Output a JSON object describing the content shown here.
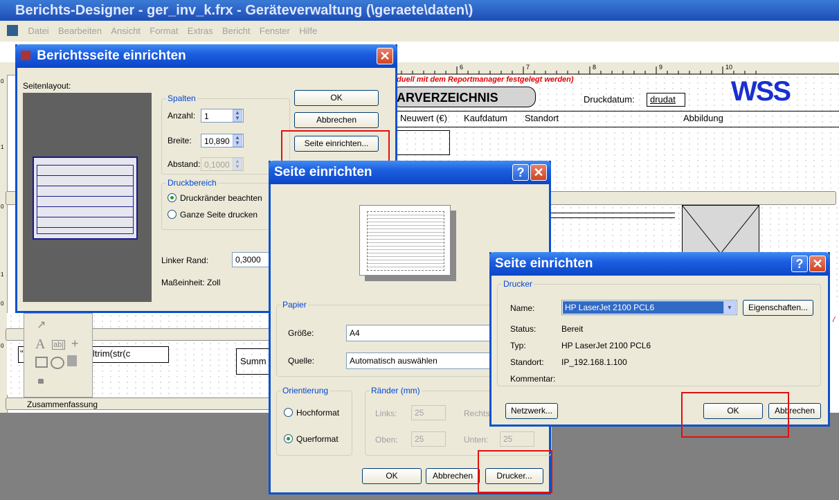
{
  "app": {
    "title": "Berichts-Designer - ger_inv_k.frx - Geräteverwaltung (\\geraete\\daten\\)",
    "menu": [
      "Datei",
      "Bearbeiten",
      "Ansicht",
      "Format",
      "Extras",
      "Bericht",
      "Fenster",
      "Hilfe"
    ]
  },
  "report": {
    "ruler_numbers": [
      "6",
      "7",
      "8",
      "9",
      "10"
    ],
    "vruler_numbers": [
      "0",
      "1",
      "0",
      "1",
      "0",
      "0"
    ],
    "banner_text": "iduell mit dem Reportmanager festgelegt werden)",
    "title_box": "ARVERZEICHNIS",
    "druckdatum_label": "Druckdatum:",
    "druckdatum_field": "drudat",
    "logo": "WSS",
    "columns": [
      "Neuwert (€)",
      "Kaufdatum",
      "Standort",
      "Abbildung"
    ],
    "summary_expr": "tze: \"+ltrim(str(c",
    "summary_prefix": "\"A",
    "summary_label": "Summ",
    "band_label": "Zusammenfassung",
    "band_right_char": "/"
  },
  "dialog1": {
    "title": "Berichtsseite einrichten",
    "seitenlayout_label": "Seitenlayout:",
    "spalten_group": "Spalten",
    "anzahl_label": "Anzahl:",
    "anzahl_value": "1",
    "breite_label": "Breite:",
    "breite_value": "10,890",
    "abstand_label": "Abstand:",
    "abstand_value": "0,1000",
    "druckbereich_group": "Druckbereich",
    "druckraender": "Druckränder beachten",
    "ganze_seite": "Ganze Seite drucken",
    "linker_rand_label": "Linker Rand:",
    "linker_rand_value": "0,3000",
    "masseinheit": "Maßeinheit: Zoll",
    "ok": "OK",
    "abbrechen": "Abbrechen",
    "seite_einrichten": "Seite einrichten..."
  },
  "dialog2": {
    "title": "Seite einrichten",
    "papier_group": "Papier",
    "groesse_label": "Größe:",
    "groesse_value": "A4",
    "quelle_label": "Quelle:",
    "quelle_value": "Automatisch auswählen",
    "orientierung_group": "Orientierung",
    "hochformat": "Hochformat",
    "querformat": "Querformat",
    "raender_group": "Ränder (mm)",
    "links_label": "Links:",
    "links_value": "25",
    "rechts_label": "Rechts",
    "oben_label": "Oben:",
    "oben_value": "25",
    "unten_label": "Unten:",
    "unten_value": "25",
    "ok": "OK",
    "abbrechen": "Abbrechen",
    "drucker": "Drucker..."
  },
  "dialog3": {
    "title": "Seite einrichten",
    "drucker_group": "Drucker",
    "name_label": "Name:",
    "name_value": "HP LaserJet 2100 PCL6",
    "eigenschaften": "Eigenschaften...",
    "status_label": "Status:",
    "status_value": "Bereit",
    "typ_label": "Typ:",
    "typ_value": "HP LaserJet 2100 PCL6",
    "standort_label": "Standort:",
    "standort_value": "IP_192.168.1.100",
    "kommentar_label": "Kommentar:",
    "netzwerk": "Netzwerk...",
    "ok": "OK",
    "abbrechen": "Abbrechen"
  },
  "colors": {
    "title_blue": "#0a46c8",
    "highlight_red": "#e01010",
    "group_label_blue": "#0046d5",
    "selection_blue": "#316ac5"
  }
}
